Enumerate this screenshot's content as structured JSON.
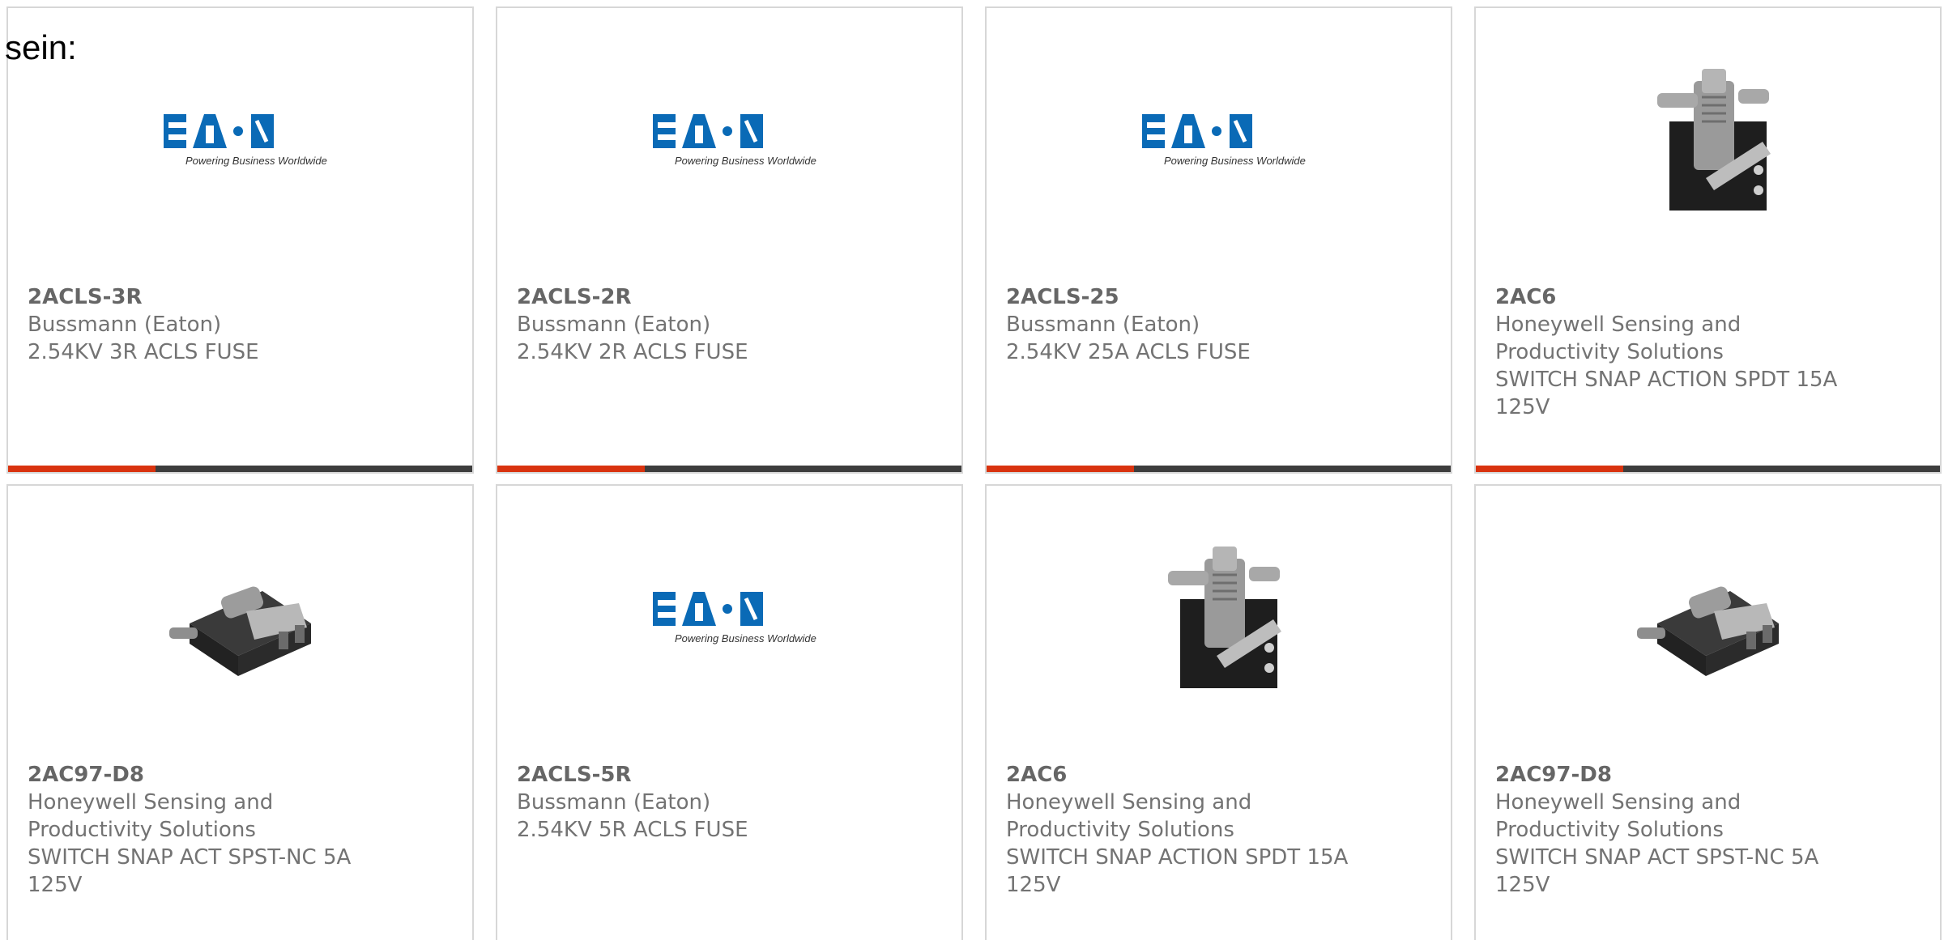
{
  "intro_text": "sein:",
  "brand": {
    "accent_color": "#d9330f",
    "bar_color": "#3d3d3d",
    "eaton_blue": "#0a6ab6"
  },
  "products": [
    {
      "part_number": "2ACLS-3R",
      "manufacturer": "Bussmann (Eaton)",
      "description": "2.54KV 3R ACLS FUSE",
      "image": "eaton-logo",
      "logo_text": "E T N",
      "logo_tagline": "Powering Business Worldwide"
    },
    {
      "part_number": "2ACLS-2R",
      "manufacturer": "Bussmann (Eaton)",
      "description": "2.54KV 2R ACLS FUSE",
      "image": "eaton-logo",
      "logo_text": "E T N",
      "logo_tagline": "Powering Business Worldwide"
    },
    {
      "part_number": "2ACLS-25",
      "manufacturer": "Bussmann (Eaton)",
      "description": "2.54KV 25A ACLS FUSE",
      "image": "eaton-logo",
      "logo_text": "E T N",
      "logo_tagline": "Powering Business Worldwide"
    },
    {
      "part_number": "2AC6",
      "manufacturer_line1": "Honeywell Sensing and",
      "manufacturer_line2": "Productivity Solutions",
      "description_line1": "SWITCH SNAP ACTION SPDT 15A",
      "description_line2": "125V",
      "image": "snap-switch-upright-photo"
    },
    {
      "part_number": "2AC97-D8",
      "manufacturer_line1": "Honeywell Sensing and",
      "manufacturer_line2": "Productivity Solutions",
      "description_line1": "SWITCH SNAP ACT SPST-NC 5A",
      "description_line2": "125V",
      "image": "snap-switch-angled-photo"
    },
    {
      "part_number": "2ACLS-5R",
      "manufacturer": "Bussmann (Eaton)",
      "description": "2.54KV 5R ACLS FUSE",
      "image": "eaton-logo",
      "logo_text": "E T N",
      "logo_tagline": "Powering Business Worldwide"
    },
    {
      "part_number": "2AC6",
      "manufacturer_line1": "Honeywell Sensing and",
      "manufacturer_line2": "Productivity Solutions",
      "description_line1": "SWITCH SNAP ACTION SPDT 15A",
      "description_line2": "125V",
      "image": "snap-switch-upright-photo"
    },
    {
      "part_number": "2AC97-D8",
      "manufacturer_line1": "Honeywell Sensing and",
      "manufacturer_line2": "Productivity Solutions",
      "description_line1": "SWITCH SNAP ACT SPST-NC 5A",
      "description_line2": "125V",
      "image": "snap-switch-angled-photo"
    }
  ]
}
